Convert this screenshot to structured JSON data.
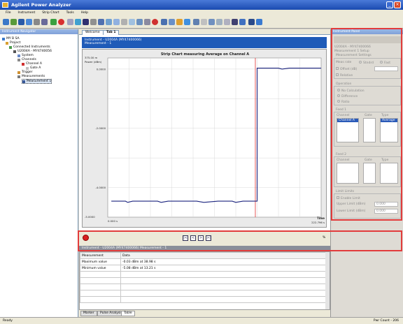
{
  "window": {
    "title": "Agilent Power Analyzer"
  },
  "menu": [
    "File",
    "Instrument",
    "Strip Chart",
    "Tools",
    "Help"
  ],
  "nav": {
    "title": "Instrument Navigator",
    "items": [
      "MY B SA",
      "Project",
      "Connected Instruments",
      "U2004A - MY4740056",
      "System",
      "Channels",
      "Channel A",
      "Gate A",
      "Trigger",
      "Measurements",
      "Measurement 1"
    ]
  },
  "tabs": [
    "Welcome",
    "Tab 1"
  ],
  "instrument": {
    "line1": "Instrument - U2004A (MY47400066)",
    "line2": "Measurement - 1"
  },
  "chart_data": {
    "type": "line",
    "title": "Strip Chart measuring Average on Channel A",
    "y_axis_label": "Power\n(dBm)",
    "y_max_label": "375.00 m",
    "yticks": [
      "0.0000",
      "-2.0000",
      "-4.0000"
    ],
    "ymin_label": "-5.0000",
    "xmin_label": "0.000 s",
    "x_axis_label": "Time",
    "x_right_label": "222.796 s",
    "ylim": [
      -5.0,
      0.375
    ],
    "xlim": [
      0,
      60
    ],
    "series": [
      {
        "values": [
          [
            1,
            -4.46
          ],
          [
            5,
            -4.46
          ],
          [
            5.6,
            -4.5
          ],
          [
            7,
            -4.46
          ],
          [
            14,
            -4.46
          ],
          [
            15,
            -4.5
          ],
          [
            16,
            -4.48
          ],
          [
            17,
            -4.46
          ],
          [
            25,
            -4.46
          ],
          [
            27,
            -4.5
          ],
          [
            29,
            -4.48
          ],
          [
            31,
            -4.46
          ],
          [
            35,
            -4.46
          ],
          [
            36,
            -4.5
          ],
          [
            38,
            -4.46
          ],
          [
            42,
            -4.46
          ],
          [
            42,
            0.03
          ],
          [
            48,
            0.03
          ],
          [
            49,
            0.0
          ],
          [
            51,
            0.03
          ],
          [
            60,
            0.03
          ]
        ]
      }
    ],
    "marker_x": 41.5
  },
  "controls": {
    "percent": "%"
  },
  "table": {
    "title": "Instrument - U2004A (MY47400066) Measurement - 1",
    "headers": [
      "Measurement",
      "Data"
    ],
    "rows": [
      [
        "Maximum value",
        "-0.03 dBm at 38.98 s"
      ],
      [
        "Minimum value",
        "-5.08 dBm at 13.21 s"
      ]
    ]
  },
  "bottom_tabs": [
    "Marker",
    "Pulse Analysis",
    "Table"
  ],
  "panel": {
    "title": "Instrument Panel",
    "device": "U2004A - MY47400066",
    "sub": "Measurement 1 Setup",
    "section": "Measurement Settings",
    "meas_label": "Meas rate",
    "radio_opts": [
      "Stndrd",
      "Fast"
    ],
    "offset_label": "Offset (dB)",
    "relative_label": "Relative",
    "operation": "Operation",
    "op_opts": [
      "No Calculation",
      "Difference",
      "Ratio"
    ],
    "feed1": "Feed 1",
    "feed2": "Feed 2",
    "feed_cols": [
      "Channel",
      "Gate",
      "Type"
    ],
    "feed1_sel": "Channel A",
    "feed1_type": "Average",
    "limits": "Limit Limits",
    "enable_limit": "Enable Limit",
    "upper": "Upper Limit (dBm)",
    "lower": "Lower Limit (dBm)",
    "upper_val": "0.000",
    "lower_val": "0.000"
  },
  "status": {
    "left": "Ready",
    "right": "Pwr Count - 206"
  }
}
